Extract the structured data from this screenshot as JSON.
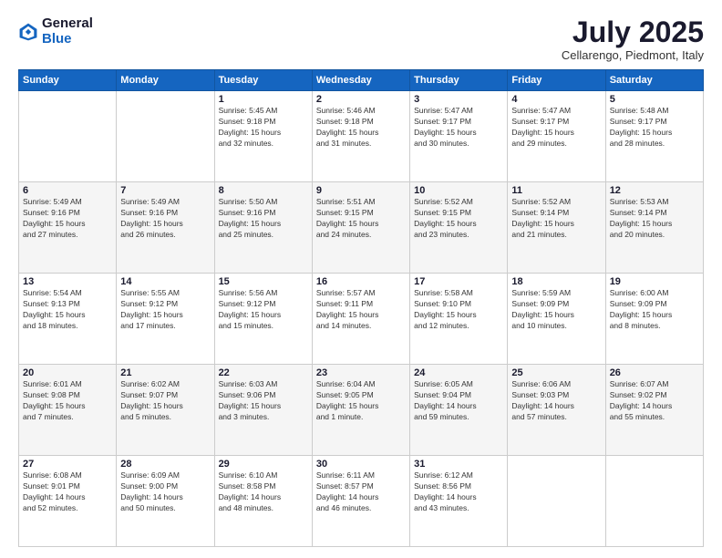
{
  "header": {
    "logo_general": "General",
    "logo_blue": "Blue",
    "month_title": "July 2025",
    "location": "Cellarengo, Piedmont, Italy"
  },
  "weekdays": [
    "Sunday",
    "Monday",
    "Tuesday",
    "Wednesday",
    "Thursday",
    "Friday",
    "Saturday"
  ],
  "weeks": [
    [
      {
        "day": "",
        "info": ""
      },
      {
        "day": "",
        "info": ""
      },
      {
        "day": "1",
        "info": "Sunrise: 5:45 AM\nSunset: 9:18 PM\nDaylight: 15 hours\nand 32 minutes."
      },
      {
        "day": "2",
        "info": "Sunrise: 5:46 AM\nSunset: 9:18 PM\nDaylight: 15 hours\nand 31 minutes."
      },
      {
        "day": "3",
        "info": "Sunrise: 5:47 AM\nSunset: 9:17 PM\nDaylight: 15 hours\nand 30 minutes."
      },
      {
        "day": "4",
        "info": "Sunrise: 5:47 AM\nSunset: 9:17 PM\nDaylight: 15 hours\nand 29 minutes."
      },
      {
        "day": "5",
        "info": "Sunrise: 5:48 AM\nSunset: 9:17 PM\nDaylight: 15 hours\nand 28 minutes."
      }
    ],
    [
      {
        "day": "6",
        "info": "Sunrise: 5:49 AM\nSunset: 9:16 PM\nDaylight: 15 hours\nand 27 minutes."
      },
      {
        "day": "7",
        "info": "Sunrise: 5:49 AM\nSunset: 9:16 PM\nDaylight: 15 hours\nand 26 minutes."
      },
      {
        "day": "8",
        "info": "Sunrise: 5:50 AM\nSunset: 9:16 PM\nDaylight: 15 hours\nand 25 minutes."
      },
      {
        "day": "9",
        "info": "Sunrise: 5:51 AM\nSunset: 9:15 PM\nDaylight: 15 hours\nand 24 minutes."
      },
      {
        "day": "10",
        "info": "Sunrise: 5:52 AM\nSunset: 9:15 PM\nDaylight: 15 hours\nand 23 minutes."
      },
      {
        "day": "11",
        "info": "Sunrise: 5:52 AM\nSunset: 9:14 PM\nDaylight: 15 hours\nand 21 minutes."
      },
      {
        "day": "12",
        "info": "Sunrise: 5:53 AM\nSunset: 9:14 PM\nDaylight: 15 hours\nand 20 minutes."
      }
    ],
    [
      {
        "day": "13",
        "info": "Sunrise: 5:54 AM\nSunset: 9:13 PM\nDaylight: 15 hours\nand 18 minutes."
      },
      {
        "day": "14",
        "info": "Sunrise: 5:55 AM\nSunset: 9:12 PM\nDaylight: 15 hours\nand 17 minutes."
      },
      {
        "day": "15",
        "info": "Sunrise: 5:56 AM\nSunset: 9:12 PM\nDaylight: 15 hours\nand 15 minutes."
      },
      {
        "day": "16",
        "info": "Sunrise: 5:57 AM\nSunset: 9:11 PM\nDaylight: 15 hours\nand 14 minutes."
      },
      {
        "day": "17",
        "info": "Sunrise: 5:58 AM\nSunset: 9:10 PM\nDaylight: 15 hours\nand 12 minutes."
      },
      {
        "day": "18",
        "info": "Sunrise: 5:59 AM\nSunset: 9:09 PM\nDaylight: 15 hours\nand 10 minutes."
      },
      {
        "day": "19",
        "info": "Sunrise: 6:00 AM\nSunset: 9:09 PM\nDaylight: 15 hours\nand 8 minutes."
      }
    ],
    [
      {
        "day": "20",
        "info": "Sunrise: 6:01 AM\nSunset: 9:08 PM\nDaylight: 15 hours\nand 7 minutes."
      },
      {
        "day": "21",
        "info": "Sunrise: 6:02 AM\nSunset: 9:07 PM\nDaylight: 15 hours\nand 5 minutes."
      },
      {
        "day": "22",
        "info": "Sunrise: 6:03 AM\nSunset: 9:06 PM\nDaylight: 15 hours\nand 3 minutes."
      },
      {
        "day": "23",
        "info": "Sunrise: 6:04 AM\nSunset: 9:05 PM\nDaylight: 15 hours\nand 1 minute."
      },
      {
        "day": "24",
        "info": "Sunrise: 6:05 AM\nSunset: 9:04 PM\nDaylight: 14 hours\nand 59 minutes."
      },
      {
        "day": "25",
        "info": "Sunrise: 6:06 AM\nSunset: 9:03 PM\nDaylight: 14 hours\nand 57 minutes."
      },
      {
        "day": "26",
        "info": "Sunrise: 6:07 AM\nSunset: 9:02 PM\nDaylight: 14 hours\nand 55 minutes."
      }
    ],
    [
      {
        "day": "27",
        "info": "Sunrise: 6:08 AM\nSunset: 9:01 PM\nDaylight: 14 hours\nand 52 minutes."
      },
      {
        "day": "28",
        "info": "Sunrise: 6:09 AM\nSunset: 9:00 PM\nDaylight: 14 hours\nand 50 minutes."
      },
      {
        "day": "29",
        "info": "Sunrise: 6:10 AM\nSunset: 8:58 PM\nDaylight: 14 hours\nand 48 minutes."
      },
      {
        "day": "30",
        "info": "Sunrise: 6:11 AM\nSunset: 8:57 PM\nDaylight: 14 hours\nand 46 minutes."
      },
      {
        "day": "31",
        "info": "Sunrise: 6:12 AM\nSunset: 8:56 PM\nDaylight: 14 hours\nand 43 minutes."
      },
      {
        "day": "",
        "info": ""
      },
      {
        "day": "",
        "info": ""
      }
    ]
  ]
}
